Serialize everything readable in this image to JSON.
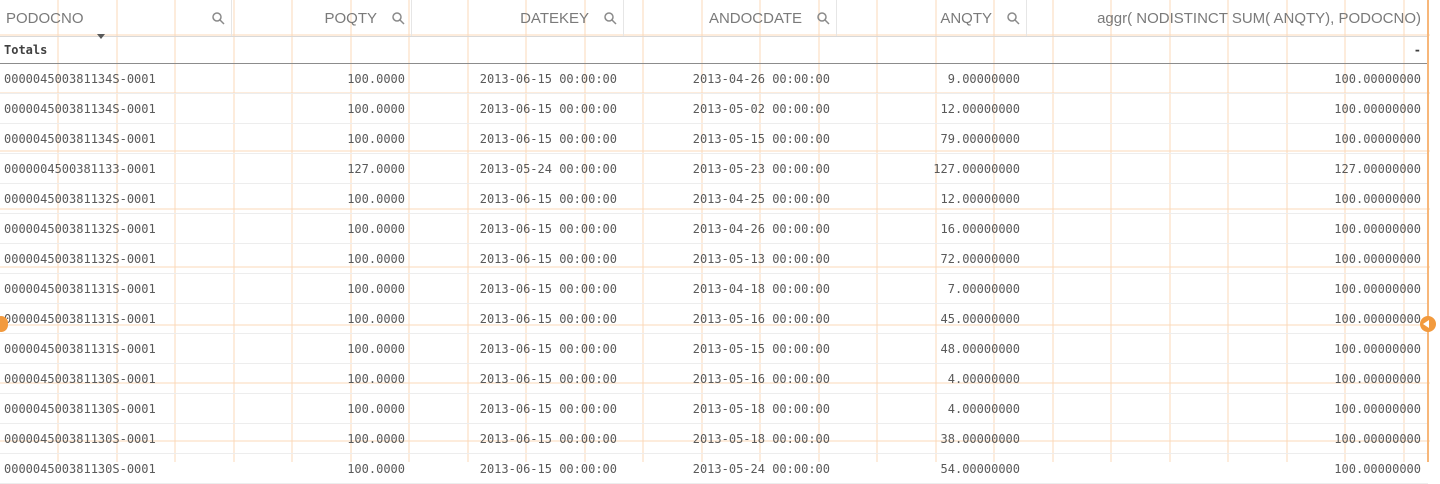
{
  "columns": [
    {
      "label": "PODOCNO",
      "align": "left"
    },
    {
      "label": "POQTY",
      "align": "right"
    },
    {
      "label": "DATEKEY",
      "align": "right"
    },
    {
      "label": "ANDOCDATE",
      "align": "right"
    },
    {
      "label": "ANQTY",
      "align": "right"
    },
    {
      "label": "aggr( NODISTINCT SUM( ANQTY), PODOCNO)",
      "align": "right"
    }
  ],
  "totals": {
    "label": "Totals",
    "last_value": "-"
  },
  "rows": [
    [
      "000004500381134S-0001",
      "100.0000",
      "2013-06-15 00:00:00",
      "2013-04-26 00:00:00",
      "9.00000000",
      "100.00000000"
    ],
    [
      "000004500381134S-0001",
      "100.0000",
      "2013-06-15 00:00:00",
      "2013-05-02 00:00:00",
      "12.00000000",
      "100.00000000"
    ],
    [
      "000004500381134S-0001",
      "100.0000",
      "2013-06-15 00:00:00",
      "2013-05-15 00:00:00",
      "79.00000000",
      "100.00000000"
    ],
    [
      "0000004500381133-0001",
      "127.0000",
      "2013-05-24 00:00:00",
      "2013-05-23 00:00:00",
      "127.00000000",
      "127.00000000"
    ],
    [
      "000004500381132S-0001",
      "100.0000",
      "2013-06-15 00:00:00",
      "2013-04-25 00:00:00",
      "12.00000000",
      "100.00000000"
    ],
    [
      "000004500381132S-0001",
      "100.0000",
      "2013-06-15 00:00:00",
      "2013-04-26 00:00:00",
      "16.00000000",
      "100.00000000"
    ],
    [
      "000004500381132S-0001",
      "100.0000",
      "2013-06-15 00:00:00",
      "2013-05-13 00:00:00",
      "72.00000000",
      "100.00000000"
    ],
    [
      "000004500381131S-0001",
      "100.0000",
      "2013-06-15 00:00:00",
      "2013-04-18 00:00:00",
      "7.00000000",
      "100.00000000"
    ],
    [
      "000004500381131S-0001",
      "100.0000",
      "2013-06-15 00:00:00",
      "2013-05-16 00:00:00",
      "45.00000000",
      "100.00000000"
    ],
    [
      "000004500381131S-0001",
      "100.0000",
      "2013-06-15 00:00:00",
      "2013-05-15 00:00:00",
      "48.00000000",
      "100.00000000"
    ],
    [
      "000004500381130S-0001",
      "100.0000",
      "2013-06-15 00:00:00",
      "2013-05-16 00:00:00",
      "4.00000000",
      "100.00000000"
    ],
    [
      "000004500381130S-0001",
      "100.0000",
      "2013-06-15 00:00:00",
      "2013-05-18 00:00:00",
      "4.00000000",
      "100.00000000"
    ],
    [
      "000004500381130S-0001",
      "100.0000",
      "2013-06-15 00:00:00",
      "2013-05-18 00:00:00",
      "38.00000000",
      "100.00000000"
    ],
    [
      "000004500381130S-0001",
      "100.0000",
      "2013-06-15 00:00:00",
      "2013-05-24 00:00:00",
      "54.00000000",
      "100.00000000"
    ]
  ],
  "colors": {
    "accent": "#f29a3e",
    "guide": "#fbd9b8"
  }
}
